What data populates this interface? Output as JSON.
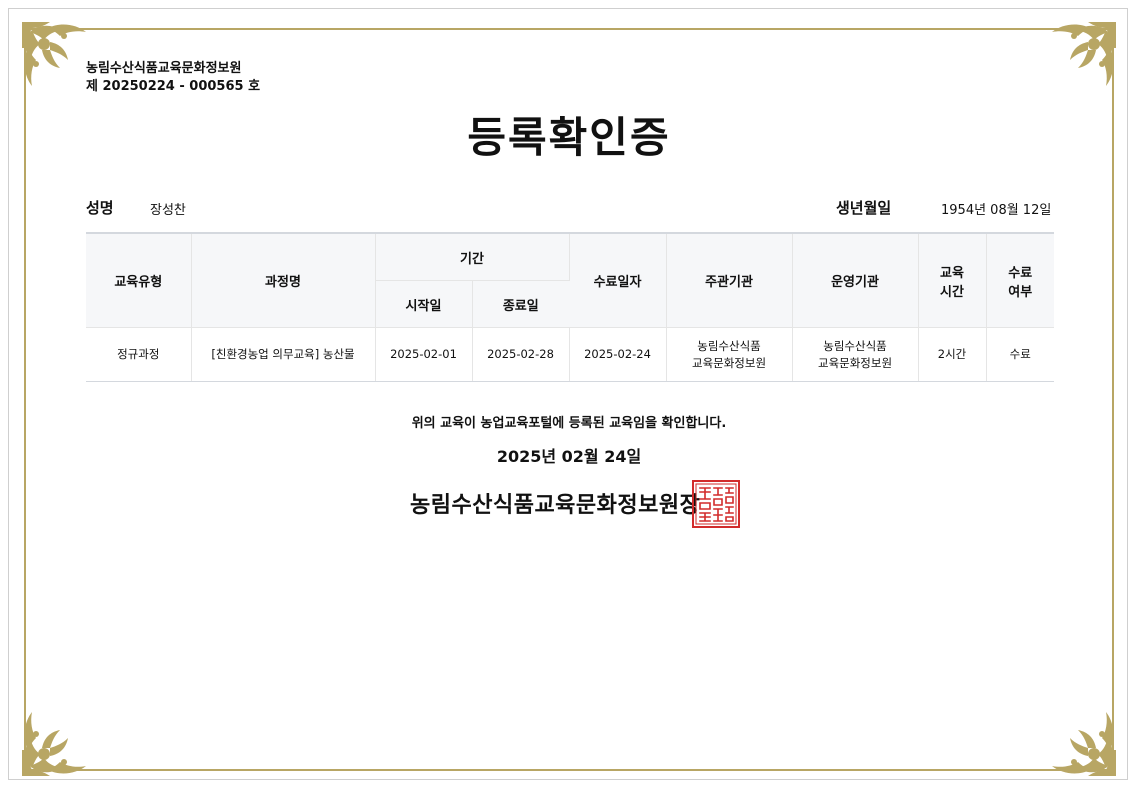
{
  "issuer_org": "농림수산식품교육문화정보원",
  "cert_number": "제 20250224 - 000565 호",
  "title": "등록확인증",
  "name_label": "성명",
  "name_value": "장성찬",
  "birth_label": "생년월일",
  "birth_value": "1954년 08월 12일",
  "table": {
    "headers": {
      "type": "교육유형",
      "course": "과정명",
      "period": "기간",
      "start": "시작일",
      "end": "종료일",
      "completion_date": "수료일자",
      "host": "주관기관",
      "operator": "운영기관",
      "hours_line1": "교육",
      "hours_line2": "시간",
      "status_line1": "수료",
      "status_line2": "여부"
    },
    "rows": [
      {
        "type": "정규과정",
        "course": "[친환경농업 의무교육] 농산물",
        "start": "2025-02-01",
        "end": "2025-02-28",
        "completion_date": "2025-02-24",
        "host_line1": "농림수산식품",
        "host_line2": "교육문화정보원",
        "operator_line1": "농림수산식품",
        "operator_line2": "교육문화정보원",
        "hours": "2시간",
        "status": "수료"
      }
    ]
  },
  "confirm_text": "위의 교육이 농업교육포털에 등록된 교육임을 확인합니다.",
  "issue_date": "2025년 02월 24일",
  "issuer_title": "농림수산식품교육문화정보원장",
  "colors": {
    "frame_gold": "#b8a664",
    "seal_red": "#d22b2b",
    "header_bg": "#f6f7f9"
  }
}
